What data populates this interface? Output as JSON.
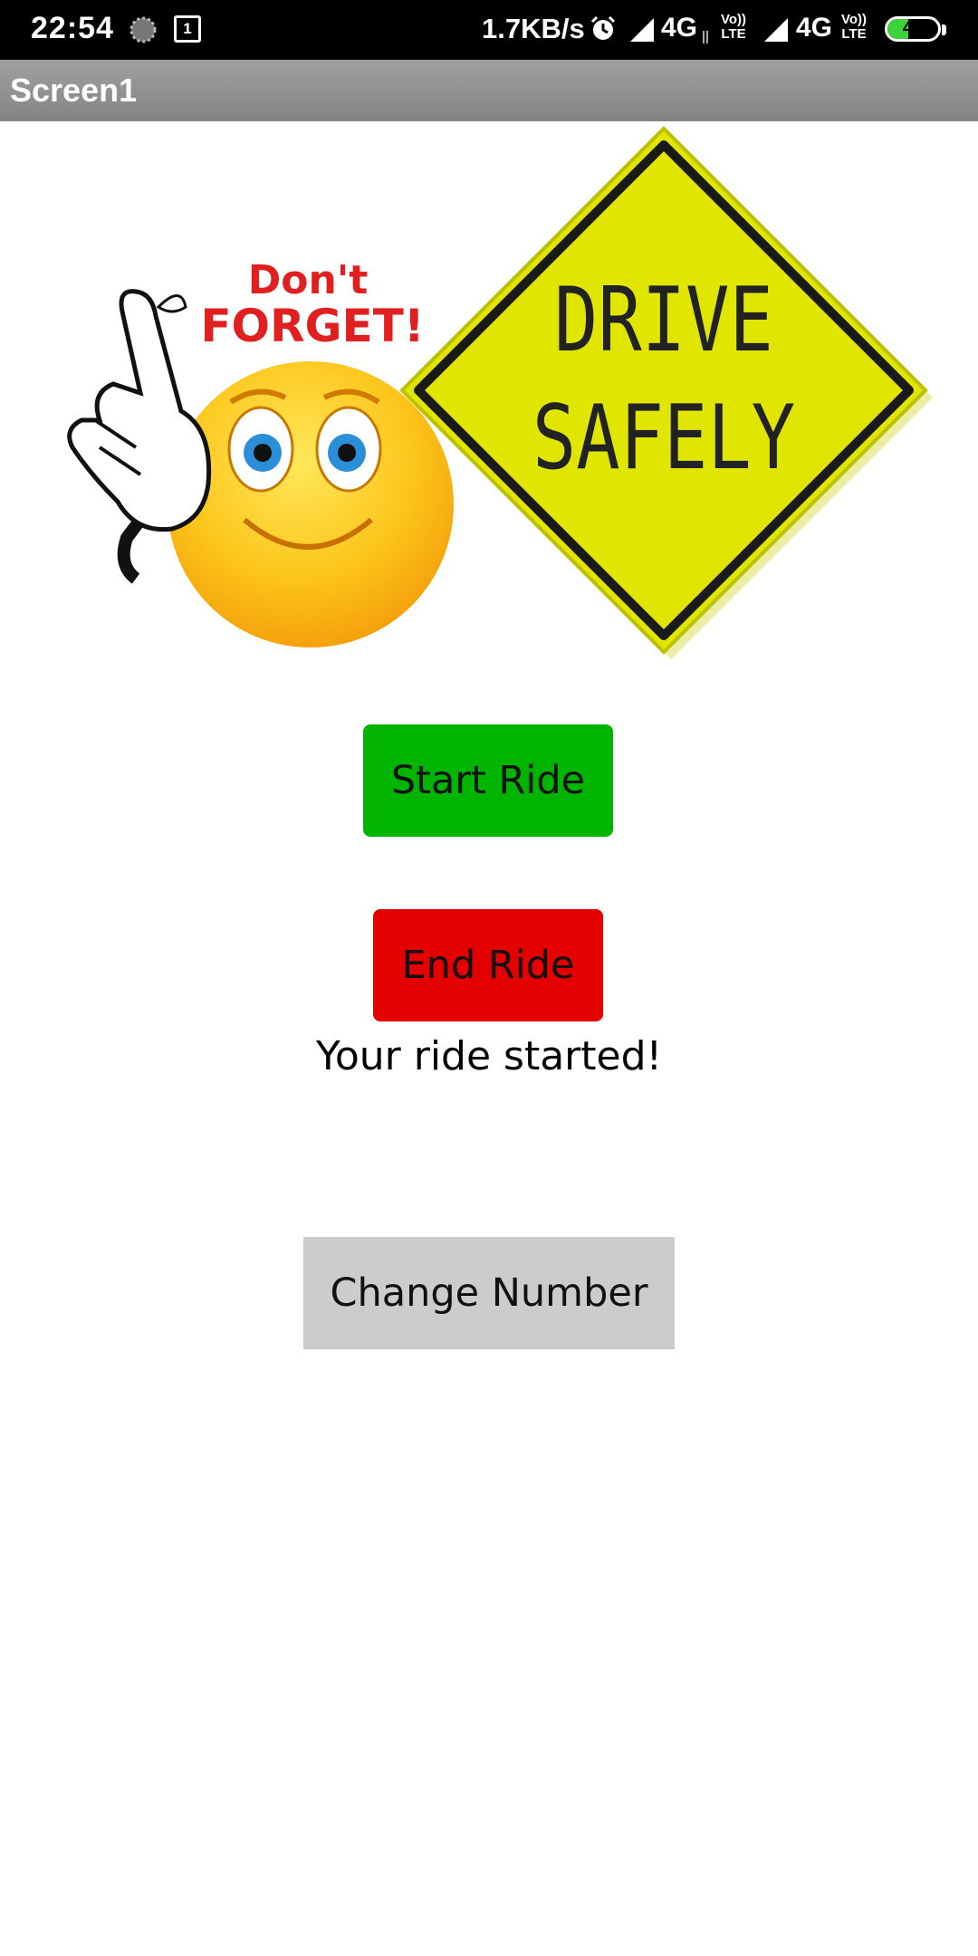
{
  "status_bar": {
    "time": "22:54",
    "notification_badge": "1",
    "net_speed": "1.7KB/s",
    "sim1_network": "4G",
    "sim2_network": "4G",
    "volte_top": "Vo))",
    "volte_bottom": "LTE",
    "battery_level": "41",
    "battery_fraction": 0.41,
    "icons": [
      "spinner-icon",
      "notification-icon",
      "alarm-icon",
      "signal-icon",
      "data-arrows-icon",
      "signal-icon",
      "battery-icon"
    ]
  },
  "title_bar": {
    "title": "Screen1"
  },
  "banner": {
    "sticker_line1": "Don't",
    "sticker_line2": "FORGET!",
    "sign_line1": "DRIVE",
    "sign_line2": "SAFELY"
  },
  "buttons": {
    "start_label": "Start Ride",
    "end_label": "End Ride",
    "change_label": "Change Number"
  },
  "status_message": "Your ride started!",
  "colors": {
    "start_button": "#00b400",
    "end_button": "#e40000",
    "change_button": "#cccccc",
    "sign_yellow": "#e1e600",
    "title_bar": "#8c8c8c"
  }
}
